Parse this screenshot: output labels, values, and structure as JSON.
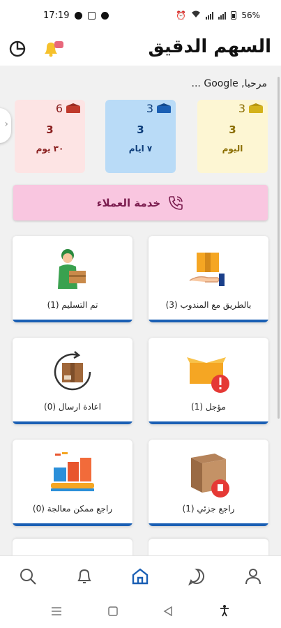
{
  "status_bar": {
    "time": "17:19",
    "battery": "56%"
  },
  "header": {
    "title": "السهم الدقيق"
  },
  "welcome_text": "مرحبا, Google ...",
  "stats": [
    {
      "id": "today",
      "top_number": "3",
      "count": "3",
      "label": "اليوم",
      "bg": "#fdf6d3",
      "text_color": "#8a6d00",
      "icon_color": "#d4b21a"
    },
    {
      "id": "week",
      "top_number": "3",
      "count": "3",
      "label": "٧ ايام",
      "bg": "#b9dbf7",
      "text_color": "#0d3d7a",
      "icon_color": "#1a5fb4"
    },
    {
      "id": "month",
      "top_number": "6",
      "count": "3",
      "label": "٣٠ يوم",
      "bg": "#fde4e4",
      "text_color": "#8a1f1f",
      "icon_color": "#c0392b"
    }
  ],
  "support_button": {
    "label": "خدمة العملاء"
  },
  "tiles": [
    {
      "id": "with-courier",
      "label": "بالطريق مع المندوب (3)"
    },
    {
      "id": "delivered",
      "label": "تم التسليم (1)"
    },
    {
      "id": "postponed",
      "label": "مؤجل (1)"
    },
    {
      "id": "resend",
      "label": "اعادة ارسال (0)"
    },
    {
      "id": "partial-return",
      "label": "راجع جزئي (1)"
    },
    {
      "id": "processable-return",
      "label": "راجع ممكن معالجة (0)"
    }
  ],
  "colors": {
    "accent": "#1a5fb4",
    "support_bg": "#f9c6e0",
    "support_text": "#7b1d4f"
  },
  "bottom_nav": [
    "search-icon",
    "bell-icon",
    "home-icon",
    "chat-icon",
    "user-icon"
  ],
  "active_nav": "home-icon"
}
